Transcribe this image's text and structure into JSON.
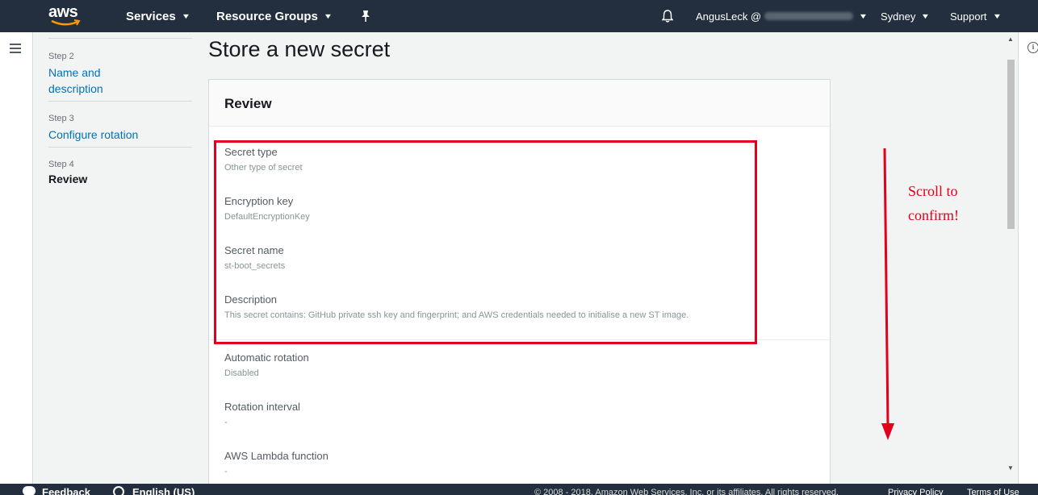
{
  "topnav": {
    "logo": "aws",
    "services": "Services",
    "resource_groups": "Resource Groups",
    "pin_icon": "pin-icon",
    "bell_icon": "bell-icon",
    "account": "AngusLeck @",
    "region": "Sydney",
    "support": "Support"
  },
  "steps": [
    {
      "num": "Step 2",
      "label": "Name and description",
      "state": "link"
    },
    {
      "num": "Step 3",
      "label": "Configure rotation",
      "state": "link"
    },
    {
      "num": "Step 4",
      "label": "Review",
      "state": "current"
    }
  ],
  "page_title": "Store a new secret",
  "panel": {
    "title": "Review",
    "fields": [
      {
        "label": "Secret type",
        "value": "Other type of secret"
      },
      {
        "label": "Encryption key",
        "value": "DefaultEncryptionKey"
      },
      {
        "label": "Secret name",
        "value": "st-boot_secrets"
      },
      {
        "label": "Description",
        "value": "This secret contains: GitHub private ssh key and fingerprint; and AWS credentials needed to initialise a new ST image."
      },
      {
        "label": "Automatic rotation",
        "value": "Disabled"
      },
      {
        "label": "Rotation interval",
        "value": "-"
      },
      {
        "label": "AWS Lambda function",
        "value": "-"
      }
    ]
  },
  "annotation": {
    "line1": "Scroll to",
    "line2": "confirm!",
    "color": "#e3001b"
  },
  "footer": {
    "feedback": "Feedback",
    "language": "English (US)",
    "copyright": "© 2008 - 2018, Amazon Web Services, Inc. or its affiliates. All rights reserved.",
    "privacy": "Privacy Policy",
    "terms": "Terms of Use"
  },
  "colors": {
    "nav_bg": "#232f3e",
    "link": "#0073bb",
    "highlight": "#e3001b"
  }
}
